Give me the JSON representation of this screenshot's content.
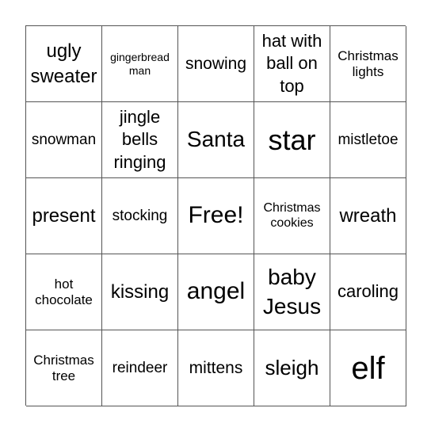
{
  "board": {
    "cells": [
      [
        "ugly sweater",
        "gingerbread man",
        "snowing",
        "hat with ball on top",
        "Christmas lights"
      ],
      [
        "snowman",
        "jingle bells ringing",
        "Santa",
        "star",
        "mistletoe"
      ],
      [
        "present",
        "stocking",
        "Free!",
        "Christmas cookies",
        "wreath"
      ],
      [
        "hot chocolate",
        "kissing",
        "angel",
        "baby Jesus",
        "caroling"
      ],
      [
        "Christmas tree",
        "reindeer",
        "mittens",
        "sleigh",
        "elf"
      ]
    ]
  }
}
